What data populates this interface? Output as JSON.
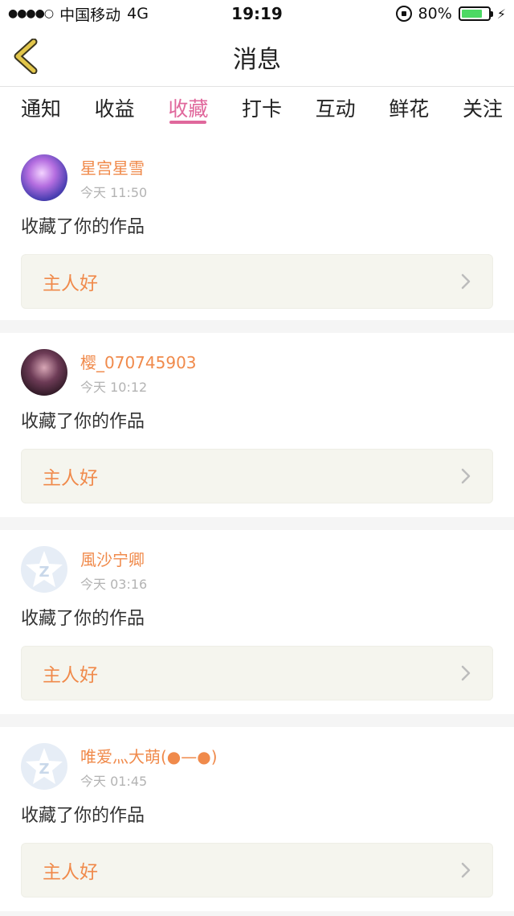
{
  "status_bar": {
    "carrier": "中国移动",
    "network": "4G",
    "time": "19:19",
    "battery": "80%",
    "battery_level": 0.8
  },
  "header": {
    "title": "消息"
  },
  "tabs": [
    {
      "label": "通知"
    },
    {
      "label": "收益"
    },
    {
      "label": "收藏",
      "active": true
    },
    {
      "label": "打卡"
    },
    {
      "label": "互动"
    },
    {
      "label": "鲜花"
    },
    {
      "label": "关注"
    }
  ],
  "items": [
    {
      "username": "星宫星雪",
      "time": "今天 11:50",
      "message": "收藏了你的作品",
      "work": "主人好"
    },
    {
      "username": "樱_070745903",
      "time": "今天 10:12",
      "message": "收藏了你的作品",
      "work": "主人好"
    },
    {
      "username": "風沙宁卿",
      "time": "今天 03:16",
      "message": "收藏了你的作品",
      "work": "主人好"
    },
    {
      "username": "唯爱灬大萌(●—●)",
      "time": "今天 01:45",
      "message": "收藏了你的作品",
      "work": "主人好"
    }
  ],
  "colors": {
    "accent": "#e0689c",
    "username": "#f08a4b",
    "back_arrow": "#e2c64a"
  }
}
